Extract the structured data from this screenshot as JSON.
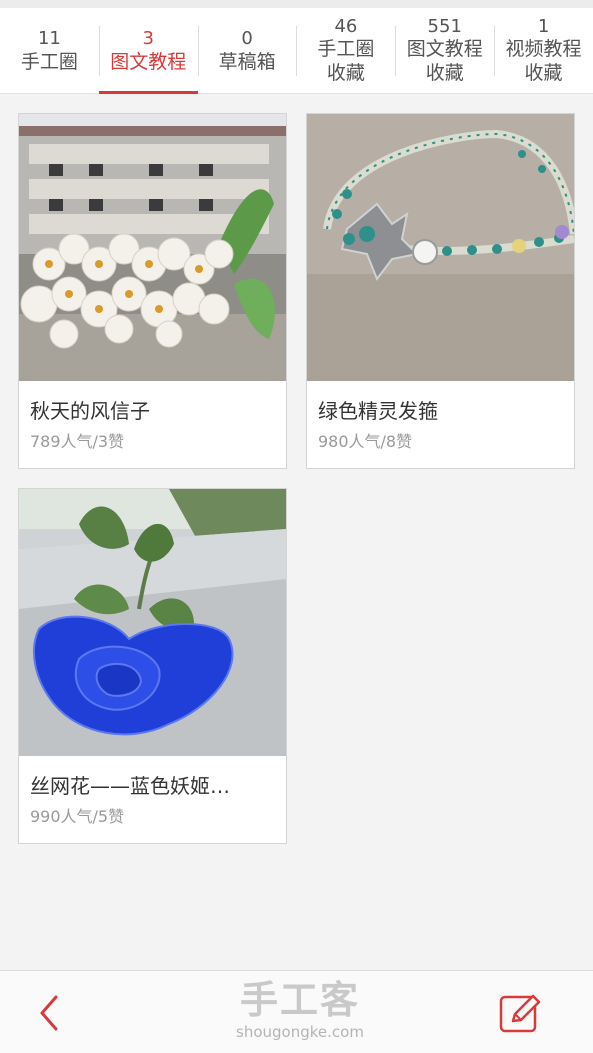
{
  "tabs": [
    {
      "count": "11",
      "label": "手工圈",
      "active": false
    },
    {
      "count": "3",
      "label": "图文教程",
      "active": true
    },
    {
      "count": "0",
      "label": "草稿箱",
      "active": false
    },
    {
      "count": "46",
      "label_line1": "手工圈",
      "label_line2": "收藏",
      "active": false
    },
    {
      "count": "551",
      "label_line1": "图文教程",
      "label_line2": "收藏",
      "active": false
    },
    {
      "count": "1",
      "label_line1": "视频教程",
      "label_line2": "收藏",
      "active": false
    }
  ],
  "cards": [
    {
      "title": "秋天的风信子",
      "meta": "789人气/3赞",
      "image": "white-flowers-photo"
    },
    {
      "title": "绿色精灵发箍",
      "meta": "980人气/8赞",
      "image": "headband-photo"
    },
    {
      "title": "丝网花——蓝色妖姬…",
      "meta": "990人气/5赞",
      "image": "blue-rose-photo"
    }
  ],
  "bottom_bar": {
    "brand": "手工客",
    "domain": "shougongke.com",
    "back_icon": "chevron-left-icon",
    "edit_icon": "edit-icon"
  },
  "colors": {
    "accent": "#d83a3a",
    "page_background": "#f3f3f3"
  }
}
